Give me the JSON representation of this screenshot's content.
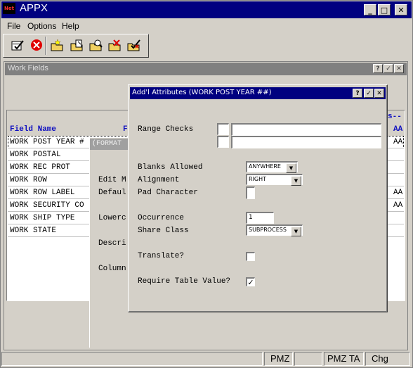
{
  "app": {
    "title": "APPX",
    "logo_text": "Net",
    "title_buttons": {
      "minimize": "_",
      "maximize": "□",
      "close": "✕"
    }
  },
  "menu": {
    "items": [
      "File",
      "Options",
      "Help"
    ]
  },
  "toolbar": {
    "icons": [
      "checklist-ok-icon",
      "cancel-icon",
      "folder-new-icon",
      "folder-edit-icon",
      "folder-search-icon",
      "folder-delete-icon",
      "folder-checklist-icon"
    ]
  },
  "work_fields": {
    "title": "Work Fields",
    "title_buttons": {
      "help": "?",
      "ok": "✓",
      "close": "✕"
    },
    "header": {
      "field_name": "Field Name",
      "col2": "F",
      "right_dash": "s--",
      "right_col": "AA"
    },
    "rows": [
      {
        "name": "WORK POST YEAR #",
        "right": "AA",
        "selected": true
      },
      {
        "name": "WORK POSTAL",
        "right": ""
      },
      {
        "name": "WORK REC PROT",
        "right": ""
      },
      {
        "name": "WORK ROW",
        "right": ""
      },
      {
        "name": "WORK ROW LABEL",
        "right": "AA"
      },
      {
        "name": "WORK SECURITY CO",
        "right": "AA"
      },
      {
        "name": "WORK SHIP TYPE",
        "right": ""
      },
      {
        "name": "WORK STATE",
        "right": ""
      }
    ]
  },
  "format_window": {
    "title": "(FORMAT",
    "labels": [
      "Edit M",
      "Defaul",
      "Lowerc",
      "Descri",
      "Column"
    ]
  },
  "dialog": {
    "title": "Add'l Attributes (WORK POST YEAR ##)",
    "title_buttons": {
      "help": "?",
      "ok": "✓",
      "close": "✕"
    },
    "range_checks_label": "Range Checks",
    "blanks_allowed_label": "Blanks Allowed",
    "blanks_allowed_value": "ANYWHERE",
    "alignment_label": "Alignment",
    "alignment_value": "RIGHT",
    "pad_character_label": "Pad Character",
    "occurrence_label": "Occurrence",
    "occurrence_value": "1",
    "share_class_label": "Share Class",
    "share_class_value": "SUBPROCESS",
    "translate_label": "Translate?",
    "translate_checked": false,
    "require_table_label": "Require Table Value?",
    "require_table_checked": true,
    "check_mark": "✓",
    "combo_arrow": "▼"
  },
  "status_bar": {
    "cells": [
      "",
      "PMZ",
      "",
      "PMZ TA",
      "Chg"
    ]
  }
}
